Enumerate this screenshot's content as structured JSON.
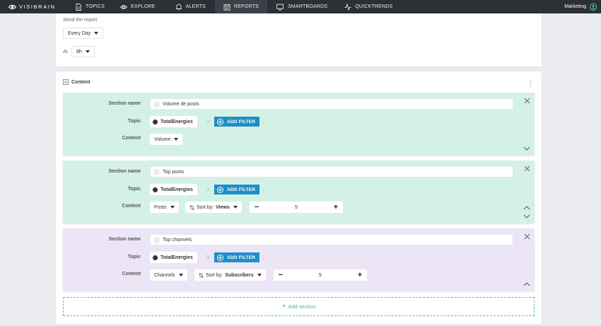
{
  "nav": {
    "brand": "VISIBRAIN",
    "items": [
      {
        "label": "TOPICS",
        "icon": "document-icon"
      },
      {
        "label": "EXPLORE",
        "icon": "eye-icon"
      },
      {
        "label": "ALERTS",
        "icon": "bell-icon"
      },
      {
        "label": "REPORTS",
        "icon": "calendar-icon",
        "active": true
      },
      {
        "label": "SMARTBOARDS",
        "icon": "monitor-icon"
      },
      {
        "label": "QUICKTRENDS",
        "icon": "pulse-icon"
      }
    ],
    "user": "Marketing"
  },
  "schedule": {
    "send_label": "Send the report",
    "frequency": "Every Day",
    "at_label": "At",
    "hour": "8h"
  },
  "content": {
    "title": "Content",
    "add_section": "Add section",
    "labels": {
      "section_name": "Section name",
      "topic": "Topic",
      "content": "Content",
      "add_filter": "ADD FILTER",
      "sort_by": "Sort by:"
    },
    "sections": [
      {
        "name": "Volume de posts",
        "topic": "TotalEnergies",
        "content_type": "Volume",
        "color": "#d4f1e5"
      },
      {
        "name": "Top posts",
        "topic": "TotalEnergies",
        "content_type": "Posts",
        "sort": "Views",
        "count": "5",
        "color": "#d4f1e5"
      },
      {
        "name": "Top channels",
        "topic": "TotalEnergies",
        "content_type": "Channels",
        "sort": "Subscribers",
        "count": "5",
        "color": "#ece5f6"
      }
    ]
  },
  "colors": {
    "accent_blue": "#1f8fc8",
    "accent_green": "#3bbf8d",
    "nav_bg": "#2c2f36"
  }
}
